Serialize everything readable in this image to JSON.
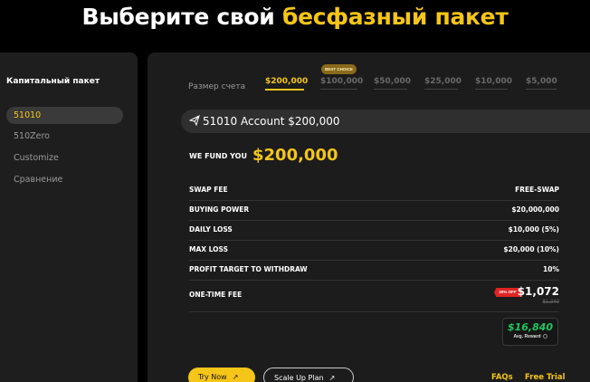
{
  "headline": {
    "prefix": "Выберите свой ",
    "accent": "бесфазный пакет"
  },
  "sidebar": {
    "title": "Капитальный пакет",
    "items": [
      {
        "label": "51010",
        "active": true
      },
      {
        "label": "510Zero",
        "active": false
      },
      {
        "label": "Customize",
        "active": false
      },
      {
        "label": "Сравнение",
        "active": false
      }
    ]
  },
  "sizes": {
    "label": "Размер счета",
    "best_badge": "BEST CHOICE",
    "tabs": [
      "$200,000",
      "$100,000",
      "$50,000",
      "$25,000",
      "$10,000",
      "$5,000"
    ],
    "selected": "$200,000"
  },
  "account": {
    "title": "51010 Account $200,000",
    "icon": "paper-plane-icon"
  },
  "fund": {
    "label": "WE FUND YOU",
    "amount": "$200,000"
  },
  "rows": [
    {
      "key": "SWAP FEE",
      "value": "FREE-SWAP"
    },
    {
      "key": "BUYING POWER",
      "value": "$20,000,000"
    },
    {
      "key": "DAILY LOSS",
      "value": "$10,000 (5%)"
    },
    {
      "key": "MAX LOSS",
      "value": "$20,000 (10%)"
    },
    {
      "key": "PROFIT TARGET TO WITHDRAW",
      "value": "10%"
    }
  ],
  "fee": {
    "label": "ONE-TIME FEE",
    "badge": "20% OFF",
    "price": "$1,072",
    "old_price": "$1,340"
  },
  "reward": {
    "value": "$16,840",
    "label": "Avg. Reward"
  },
  "buttons": {
    "try_now": "Try Now",
    "scale_up": "Scale Up Plan"
  },
  "links": {
    "faqs": "FAQs",
    "free_trial": "Free Trial"
  },
  "colors": {
    "accent": "#f5c518",
    "reward": "#22c55e",
    "badge": "#e02424"
  }
}
